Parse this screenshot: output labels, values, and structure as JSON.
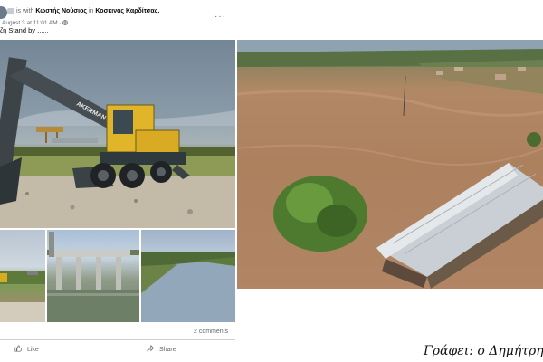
{
  "post": {
    "header_prefix": "is with",
    "tagged_user": "Κωστής Νούσιος",
    "location_prefix": "in",
    "location": "Κοσκινάς Καρδίτσας.",
    "timestamp": "August 3 at 11:01 AM · ",
    "more_label": "···",
    "text": "ζη Stand by ......",
    "comments_label": "2 comments",
    "like_label": "Like",
    "share_label": "Share"
  },
  "photos": {
    "excavator_brand": "AKERMAN"
  },
  "caption": "Γράφει: ο Δημήτρη"
}
